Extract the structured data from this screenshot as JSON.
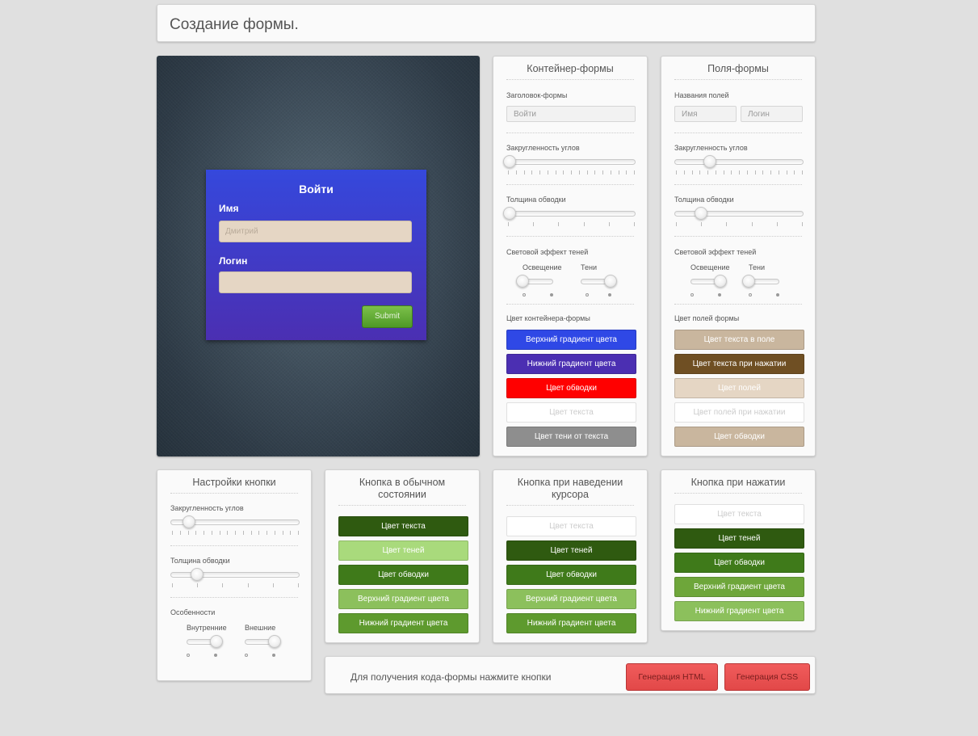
{
  "header": {
    "title": "Создание формы."
  },
  "preview": {
    "form_title": "Войти",
    "name_label": "Имя",
    "name_placeholder": "Дмитрий",
    "login_label": "Логин",
    "submit": "Submit"
  },
  "container": {
    "title": "Контейнер-формы",
    "header_label": "Заголовок-формы",
    "header_value": "Войти",
    "radius_label": "Закругленность углов",
    "border_label": "Толщина обводки",
    "shadow_label": "Световой эффект теней",
    "light_label": "Освещение",
    "shadows_label": "Тени",
    "color_label": "Цвет контейнера-формы",
    "buttons": [
      {
        "label": "Верхний градиент цвета",
        "bg": "#2f48e6",
        "fg": "#ffffff"
      },
      {
        "label": "Нижний градиент цвета",
        "bg": "#4b2fb2",
        "fg": "#ffffff"
      },
      {
        "label": "Цвет обводки",
        "bg": "#ff0000",
        "fg": "#ffffff"
      },
      {
        "label": "Цвет текста",
        "bg": "#ffffff",
        "fg": "#cccccc"
      },
      {
        "label": "Цвет тени от текста",
        "bg": "#8e8e8e",
        "fg": "#ffffff"
      }
    ]
  },
  "fields": {
    "title": "Поля-формы",
    "names_label": "Названия полей",
    "name_field": "Имя",
    "login_field": "Логин",
    "radius_label": "Закругленность углов",
    "border_label": "Толщина обводки",
    "shadow_label": "Световой эффект теней",
    "light_label": "Освещение",
    "shadows_label": "Тени",
    "color_label": "Цвет полей формы",
    "buttons": [
      {
        "label": "Цвет текста в поле",
        "bg": "#c9b69e",
        "fg": "#ffffff"
      },
      {
        "label": "Цвет текста при нажатии",
        "bg": "#6f4f23",
        "fg": "#ffffff"
      },
      {
        "label": "Цвет полей",
        "bg": "#e5d6c4",
        "fg": "#ffffff"
      },
      {
        "label": "Цвет полей при нажатии",
        "bg": "#ffffff",
        "fg": "#cccccc"
      },
      {
        "label": "Цвет обводки",
        "bg": "#c9b69e",
        "fg": "#ffffff"
      }
    ]
  },
  "button_settings": {
    "title": "Настройки кнопки",
    "radius_label": "Закругленность углов",
    "border_label": "Толщина обводки",
    "features_label": "Особенности",
    "inner_label": "Внутренние",
    "outer_label": "Внешние"
  },
  "btn_normal": {
    "title": "Кнопка в обычном состоянии",
    "buttons": [
      {
        "label": "Цвет текста",
        "bg": "#2f5a10",
        "fg": "#ffffff"
      },
      {
        "label": "Цвет теней",
        "bg": "#a9da7c",
        "fg": "#ffffff"
      },
      {
        "label": "Цвет обводки",
        "bg": "#3f7a1a",
        "fg": "#ffffff"
      },
      {
        "label": "Верхний градиент цвета",
        "bg": "#8cc05c",
        "fg": "#ffffff"
      },
      {
        "label": "Нижний градиент цвета",
        "bg": "#5e9a2e",
        "fg": "#ffffff"
      }
    ]
  },
  "btn_hover": {
    "title": "Кнопка при наведении курсора",
    "buttons": [
      {
        "label": "Цвет текста",
        "bg": "#ffffff",
        "fg": "#cccccc"
      },
      {
        "label": "Цвет теней",
        "bg": "#2f5a10",
        "fg": "#ffffff"
      },
      {
        "label": "Цвет обводки",
        "bg": "#3f7a1a",
        "fg": "#ffffff"
      },
      {
        "label": "Верхний градиент цвета",
        "bg": "#8cc05c",
        "fg": "#ffffff"
      },
      {
        "label": "Нижний градиент цвета",
        "bg": "#5e9a2e",
        "fg": "#ffffff"
      }
    ]
  },
  "btn_pressed": {
    "title": "Кнопка при нажатии",
    "buttons": [
      {
        "label": "Цвет текста",
        "bg": "#ffffff",
        "fg": "#cccccc"
      },
      {
        "label": "Цвет теней",
        "bg": "#2f5a10",
        "fg": "#ffffff"
      },
      {
        "label": "Цвет обводки",
        "bg": "#3f7a1a",
        "fg": "#ffffff"
      },
      {
        "label": "Верхний градиент цвета",
        "bg": "#6ea63a",
        "fg": "#ffffff"
      },
      {
        "label": "Нижний градиент цвета",
        "bg": "#8cc05c",
        "fg": "#ffffff"
      }
    ]
  },
  "footer": {
    "text": "Для получения кода-формы нажмите кнопки",
    "html_button": "Генерация HTML",
    "css_button": "Генерация CSS"
  }
}
